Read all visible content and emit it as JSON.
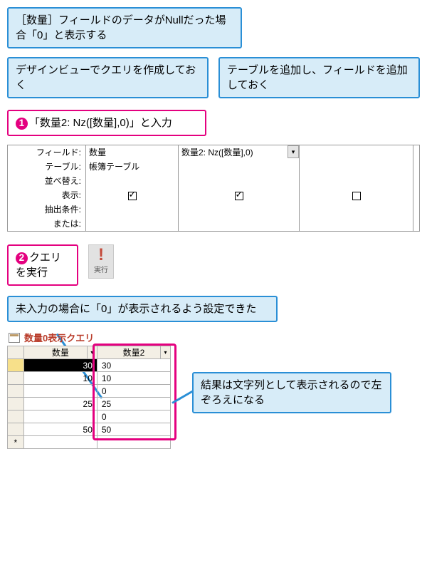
{
  "callouts": {
    "intro": "［数量］フィールドのデータがNullだった場合「0」と表示する",
    "prep_left": "デザインビューでクエリを作成しておく",
    "prep_right": "テーブルを追加し、フィールドを追加しておく",
    "step1": "「数量2: Nz([数量],0)」と入力",
    "step2": "クエリを実行",
    "result_note": "未入力の場合に「0」が表示されるよう設定できた",
    "align_note": "結果は文字列として表示されるので左ぞろえになる"
  },
  "steps": {
    "s1": "1",
    "s2": "2"
  },
  "design_grid": {
    "labels": {
      "field": "フィールド:",
      "table": "テーブル:",
      "sort": "並べ替え:",
      "show": "表示:",
      "criteria": "抽出条件:",
      "or": "または:"
    },
    "cols": [
      {
        "field": "数量",
        "table": "帳簿テーブル",
        "show": true
      },
      {
        "field": "数量2: Nz([数量],0)",
        "table": "",
        "show": true
      },
      {
        "field": "",
        "table": "",
        "show": false
      }
    ]
  },
  "run_button": {
    "label": "実行"
  },
  "result": {
    "tab_title": "数量0表示クエリ",
    "headers": {
      "c1": "数量",
      "c2": "数量2"
    },
    "rows": [
      {
        "q": "30",
        "q2": "30"
      },
      {
        "q": "10",
        "q2": "10"
      },
      {
        "q": "",
        "q2": "0"
      },
      {
        "q": "25",
        "q2": "25"
      },
      {
        "q": "",
        "q2": "0"
      },
      {
        "q": "50",
        "q2": "50"
      }
    ],
    "new_row_marker": "*"
  }
}
